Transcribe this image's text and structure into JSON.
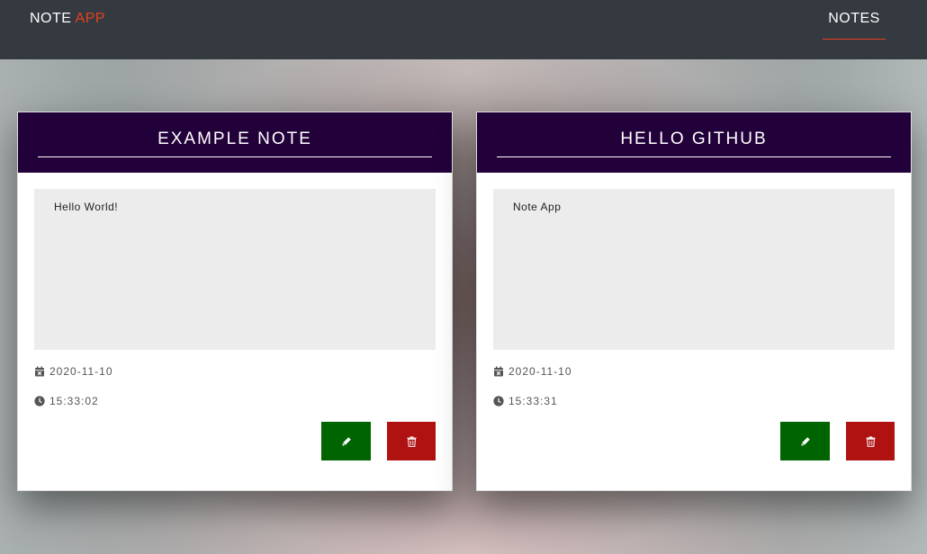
{
  "navbar": {
    "brand_primary": "NOTE",
    "brand_accent": "APP",
    "nav_link": "NOTES",
    "colors": {
      "background": "#343a40",
      "accent": "#e8401c"
    }
  },
  "notes": [
    {
      "title": "EXAMPLE NOTE",
      "body": "Hello World!",
      "date": "2020-11-10",
      "time": "15:33:02",
      "edit_icon": "pencil-icon",
      "delete_icon": "trash-icon"
    },
    {
      "title": "HELLO GITHUB",
      "body": "Note App",
      "date": "2020-11-10",
      "time": "15:33:31",
      "edit_icon": "pencil-icon",
      "delete_icon": "trash-icon"
    }
  ],
  "colors": {
    "card_header": "#22003a",
    "edit_button": "#006400",
    "delete_button": "#b01212",
    "note_body": "#ececec"
  }
}
